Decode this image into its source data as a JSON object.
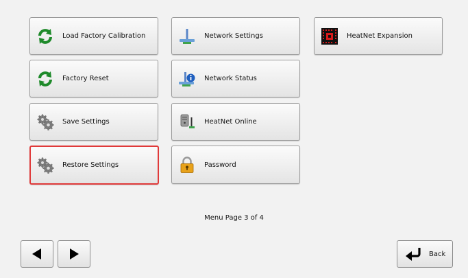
{
  "menu": {
    "col1": [
      {
        "label": "Load Factory Calibration",
        "icon": "refresh-icon"
      },
      {
        "label": "Factory Reset",
        "icon": "refresh-icon"
      },
      {
        "label": "Save Settings",
        "icon": "gears-icon"
      },
      {
        "label": "Restore Settings",
        "icon": "gears-icon"
      }
    ],
    "col2": [
      {
        "label": "Network Settings",
        "icon": "network-icon"
      },
      {
        "label": "Network Status",
        "icon": "network-info-icon"
      },
      {
        "label": "HeatNet Online",
        "icon": "server-icon"
      },
      {
        "label": "Password",
        "icon": "padlock-icon"
      }
    ],
    "col3": [
      {
        "label": "HeatNet Expansion",
        "icon": "chip-icon"
      }
    ],
    "selected": "Restore Settings"
  },
  "page_label": "Menu Page 3 of 4",
  "nav": {
    "prev_icon": "triangle-left-icon",
    "next_icon": "triangle-right-icon",
    "back_label": "Back",
    "back_icon": "return-arrow-icon"
  },
  "colors": {
    "selected_border": "#e03a3a",
    "refresh_green": "#1e8a2a",
    "chip_red": "#d81b1b"
  }
}
